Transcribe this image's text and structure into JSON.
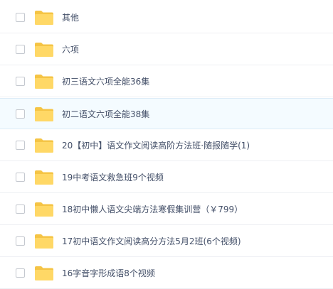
{
  "file_list": {
    "items": [
      {
        "name": "其他",
        "icon": "folder-icon"
      },
      {
        "name": "六项",
        "icon": "folder-icon"
      },
      {
        "name": "初三语文六项全能36集",
        "icon": "folder-icon"
      },
      {
        "name": "初二语文六项全能38集",
        "icon": "folder-icon"
      },
      {
        "name": "20【初中】语文作文阅读高阶方法班·随报随学(1)",
        "icon": "folder-icon"
      },
      {
        "name": "19中考语文救急班9个视频",
        "icon": "folder-icon"
      },
      {
        "name": "18初中懒人语文尖端方法寒假集训营（￥799）",
        "icon": "folder-icon"
      },
      {
        "name": "17初中语文作文阅读高分方法5月2班(6个视频)",
        "icon": "folder-icon"
      },
      {
        "name": "16字音字形成语8个视频",
        "icon": "folder-icon"
      }
    ]
  },
  "colors": {
    "folder": "#ffd866",
    "folder_tab": "#f5c445",
    "text": "#424e67",
    "hover_row": "#f4fbff"
  }
}
